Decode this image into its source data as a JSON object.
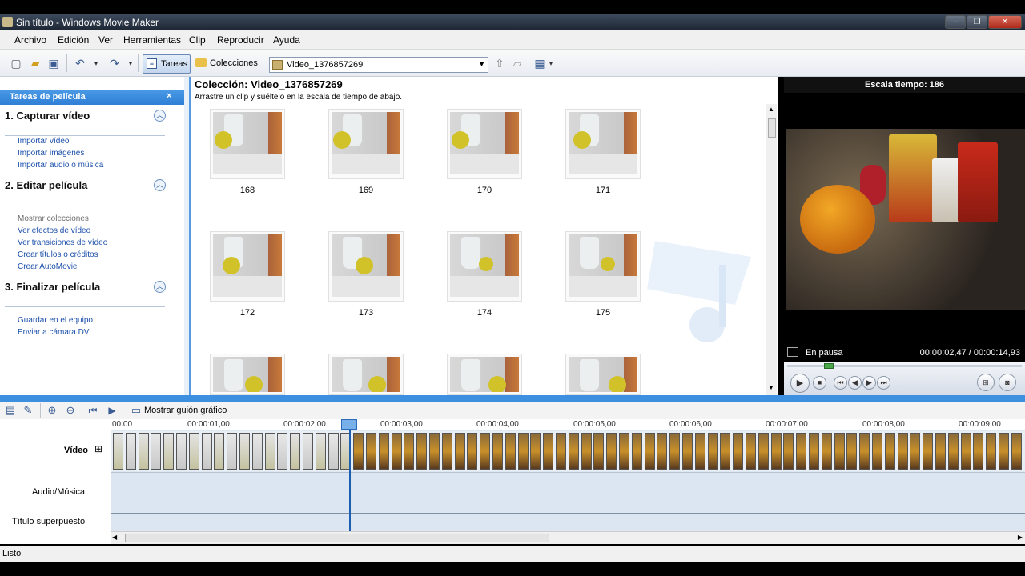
{
  "window": {
    "title": "Sin título - Windows Movie Maker",
    "minimize": "–",
    "maximize": "❐",
    "close": "✕"
  },
  "menu": [
    "Archivo",
    "Edición",
    "Ver",
    "Herramientas",
    "Clip",
    "Reproducir",
    "Ayuda"
  ],
  "toolbar": {
    "tareas_label": "Tareas",
    "colecciones_label": "Colecciones",
    "collection_select": "Video_1376857269"
  },
  "taskpane": {
    "header": "Tareas de película",
    "sections": [
      {
        "title": "1. Capturar vídeo",
        "links": [
          "Importar vídeo",
          "Importar imágenes",
          "Importar audio o música"
        ]
      },
      {
        "title": "2. Editar película",
        "links": [
          "Mostrar colecciones",
          "Ver efectos de vídeo",
          "Ver transiciones de vídeo",
          "Crear títulos o créditos",
          "Crear AutoMovie"
        ]
      },
      {
        "title": "3. Finalizar película",
        "links": [
          "Guardar en el equipo",
          "Enviar a cámara DV"
        ]
      }
    ]
  },
  "collection": {
    "title": "Colección: Video_1376857269",
    "subtitle": "Arrastre un clip y suéltelo en la escala de tiempo de abajo.",
    "clips": [
      "168",
      "169",
      "170",
      "171",
      "172",
      "173",
      "174",
      "175"
    ]
  },
  "preview": {
    "header": "Escala tiempo: 186",
    "status": "En pausa",
    "time": "00:00:02,47 / 00:00:14,93"
  },
  "timeline": {
    "storyboard_label": "Mostrar guión gráfico",
    "ruler": [
      "00.00",
      "00:00:01,00",
      "00:00:02,00",
      "00:00:03,00",
      "00:00:04,00",
      "00:00:05,00",
      "00:00:06,00",
      "00:00:07,00",
      "00:00:08,00",
      "00:00:09,00"
    ],
    "tracks": {
      "video": "Vídeo",
      "expand": "⊞",
      "audio": "Audio/Música",
      "title": "Título superpuesto"
    }
  },
  "status": "Listo"
}
